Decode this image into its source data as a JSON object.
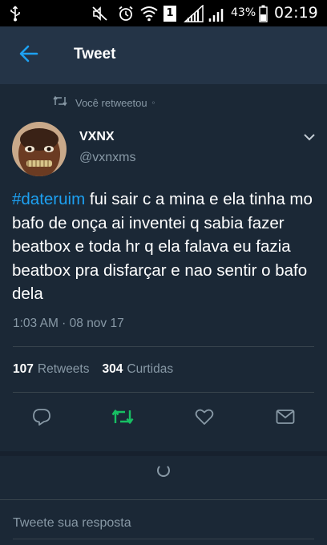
{
  "status_bar": {
    "battery": "43%",
    "time": "02:19",
    "sim_badge": "1"
  },
  "header": {
    "title": "Tweet"
  },
  "retweet_context": {
    "label": "Você retweetou"
  },
  "tweet": {
    "display_name": "VXNX",
    "handle": "@vxnxms",
    "hashtag": "#dateruim",
    "text": " fui sair c a mina e ela tinha mo bafo de onça ai inventei q sabia fazer beatbox e toda hr q ela falava eu fazia beatbox pra disfarçar e nao sentir o bafo dela",
    "timestamp": "1:03 AM · 08 nov 17"
  },
  "stats": {
    "retweets_count": "107",
    "retweets_label": "Retweets",
    "likes_count": "304",
    "likes_label": "Curtidas"
  },
  "reply": {
    "placeholder": "Tweete sua resposta"
  },
  "colors": {
    "background": "#1b2836",
    "header": "#243447",
    "accent_blue": "#1da1f2",
    "retweet_green": "#17bf63",
    "muted": "#8899a6"
  },
  "icons": [
    "usb-icon",
    "mute-icon",
    "alarm-icon",
    "wifi-icon",
    "signal-icon",
    "battery-icon",
    "back-arrow-icon",
    "retweet-icon",
    "chevron-down-icon",
    "reply-icon",
    "like-icon",
    "share-icon",
    "loading-spinner-icon"
  ]
}
